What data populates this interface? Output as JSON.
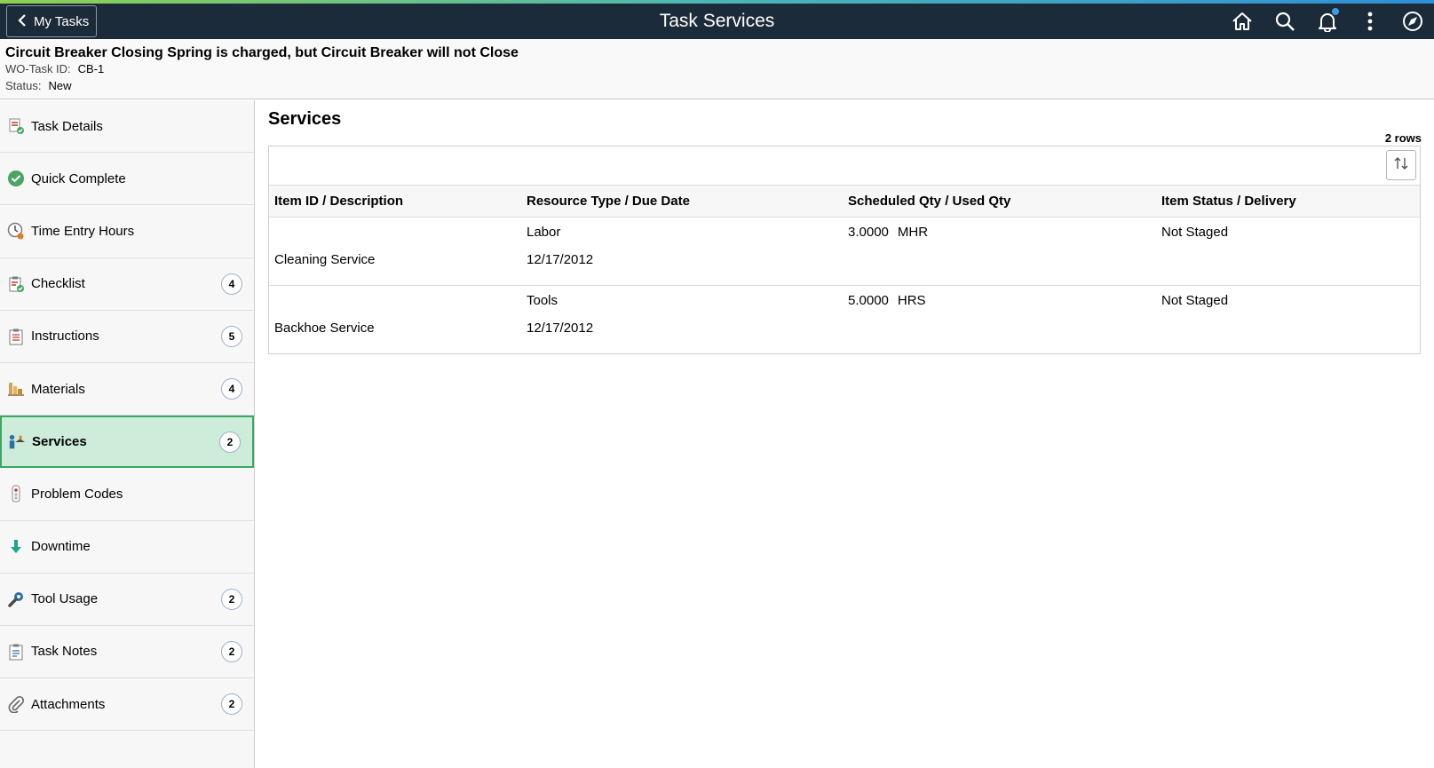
{
  "topbar": {
    "back_label": "My Tasks",
    "title": "Task Services",
    "icons": [
      "home-icon",
      "search-icon",
      "bell-icon",
      "more-icon",
      "compass-icon"
    ]
  },
  "task": {
    "title": "Circuit Breaker Closing Spring is charged, but Circuit Breaker will not Close",
    "id_label": "WO-Task ID:",
    "id_value": "CB-1",
    "status_label": "Status:",
    "status_value": "New"
  },
  "sidebar": {
    "items": [
      {
        "label": "Task Details",
        "icon": "task-details-icon",
        "count": ""
      },
      {
        "label": "Quick Complete",
        "icon": "check-circle-icon",
        "count": ""
      },
      {
        "label": "Time Entry Hours",
        "icon": "clock-icon",
        "count": ""
      },
      {
        "label": "Checklist",
        "icon": "checklist-icon",
        "count": "4"
      },
      {
        "label": "Instructions",
        "icon": "instructions-icon",
        "count": "5"
      },
      {
        "label": "Materials",
        "icon": "materials-icon",
        "count": "4"
      },
      {
        "label": "Services",
        "icon": "services-icon",
        "count": "2",
        "selected": true
      },
      {
        "label": "Problem Codes",
        "icon": "problem-codes-icon",
        "count": ""
      },
      {
        "label": "Downtime",
        "icon": "down-arrow-icon",
        "count": ""
      },
      {
        "label": "Tool Usage",
        "icon": "tool-icon",
        "count": "2"
      },
      {
        "label": "Task Notes",
        "icon": "notes-icon",
        "count": "2"
      },
      {
        "label": "Attachments",
        "icon": "paperclip-icon",
        "count": "2"
      }
    ]
  },
  "main": {
    "title": "Services",
    "row_count": "2 rows",
    "columns": [
      "Item ID / Description",
      "Resource Type / Due Date",
      "Scheduled Qty / Used Qty",
      "Item Status / Delivery"
    ],
    "rows": [
      {
        "item_id": "",
        "description": "Cleaning Service",
        "resource_type": "Labor",
        "due_date": "12/17/2012",
        "qty": "3.0000",
        "unit": "MHR",
        "status": "Not Staged"
      },
      {
        "item_id": "",
        "description": "Backhoe Service",
        "resource_type": "Tools",
        "due_date": "12/17/2012",
        "qty": "5.0000",
        "unit": "HRS",
        "status": "Not Staged"
      }
    ]
  },
  "colors": {
    "topbar_bg": "#1c2b3a",
    "selected_bg": "#cdecd9",
    "selected_border": "#3aa860"
  }
}
